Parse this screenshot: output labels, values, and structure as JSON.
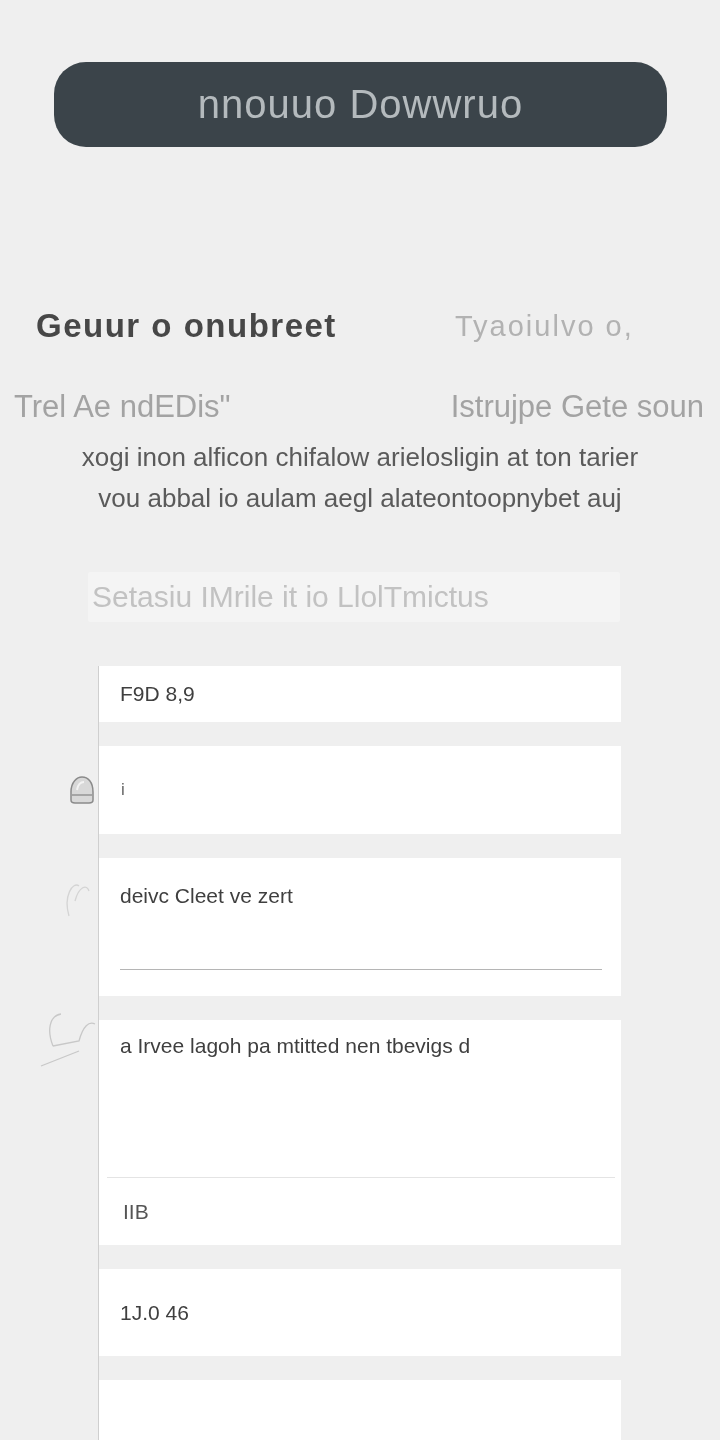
{
  "download_button": {
    "label": "nnouuo Dowwruo"
  },
  "heading": {
    "title": "Geuur o onubreet",
    "aside": "Tyaoiulvo o,"
  },
  "subheading": {
    "left": "Trel Ae ndEDis\"",
    "right": "Istrujpe Gete soun"
  },
  "description": [
    "xogi inon alficon chifalow arielosligin at ton tarier",
    "vou abbal io aulam aegl alateontoopnybet auj"
  ],
  "search_field": {
    "placeholder": "Setasiu IMrile it io LlolTmictus"
  },
  "cards": [
    {
      "kind": "text",
      "text": "F9D 8,9"
    },
    {
      "kind": "marked",
      "text": "i"
    },
    {
      "kind": "input",
      "label": "deivc Cleet ve zert"
    },
    {
      "kind": "split",
      "text": "a Irvee lagoh pa mtitted nen tbevigs d",
      "footer": "IIB"
    },
    {
      "kind": "text",
      "text": "1J.0 46"
    },
    {
      "kind": "empty"
    }
  ]
}
